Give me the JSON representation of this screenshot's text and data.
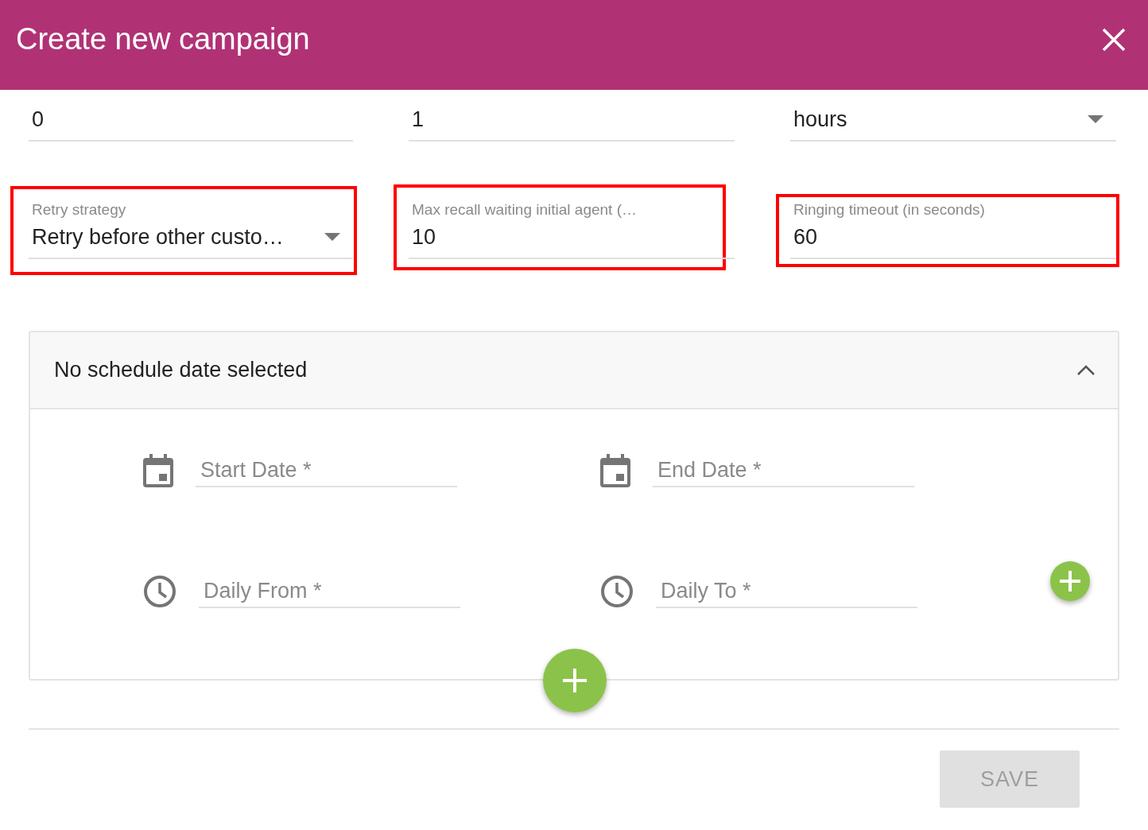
{
  "dialog": {
    "title": "Create new campaign"
  },
  "fields": [
    {
      "kind": "text",
      "value": "0",
      "highlighted": false
    },
    {
      "kind": "text",
      "value": "1",
      "highlighted": false
    },
    {
      "kind": "select",
      "value": "hours",
      "highlighted": false
    },
    {
      "kind": "select",
      "label": "Retry strategy",
      "value": "Retry before other custo…",
      "highlighted": true
    },
    {
      "kind": "text",
      "label": "Max recall waiting initial agent (…",
      "value": "10",
      "highlighted": true
    },
    {
      "kind": "text",
      "label": "Ringing timeout (in seconds)",
      "value": "60",
      "highlighted": true
    }
  ],
  "schedule": {
    "title": "No schedule date selected",
    "expanded": true,
    "inputs": [
      {
        "kind": "date",
        "placeholder": "Start Date *"
      },
      {
        "kind": "date",
        "placeholder": "End Date *"
      },
      {
        "kind": "time",
        "placeholder": "Daily From *"
      },
      {
        "kind": "time",
        "placeholder": "Daily To *"
      }
    ]
  },
  "save_button": {
    "label": "SAVE",
    "disabled": true
  }
}
